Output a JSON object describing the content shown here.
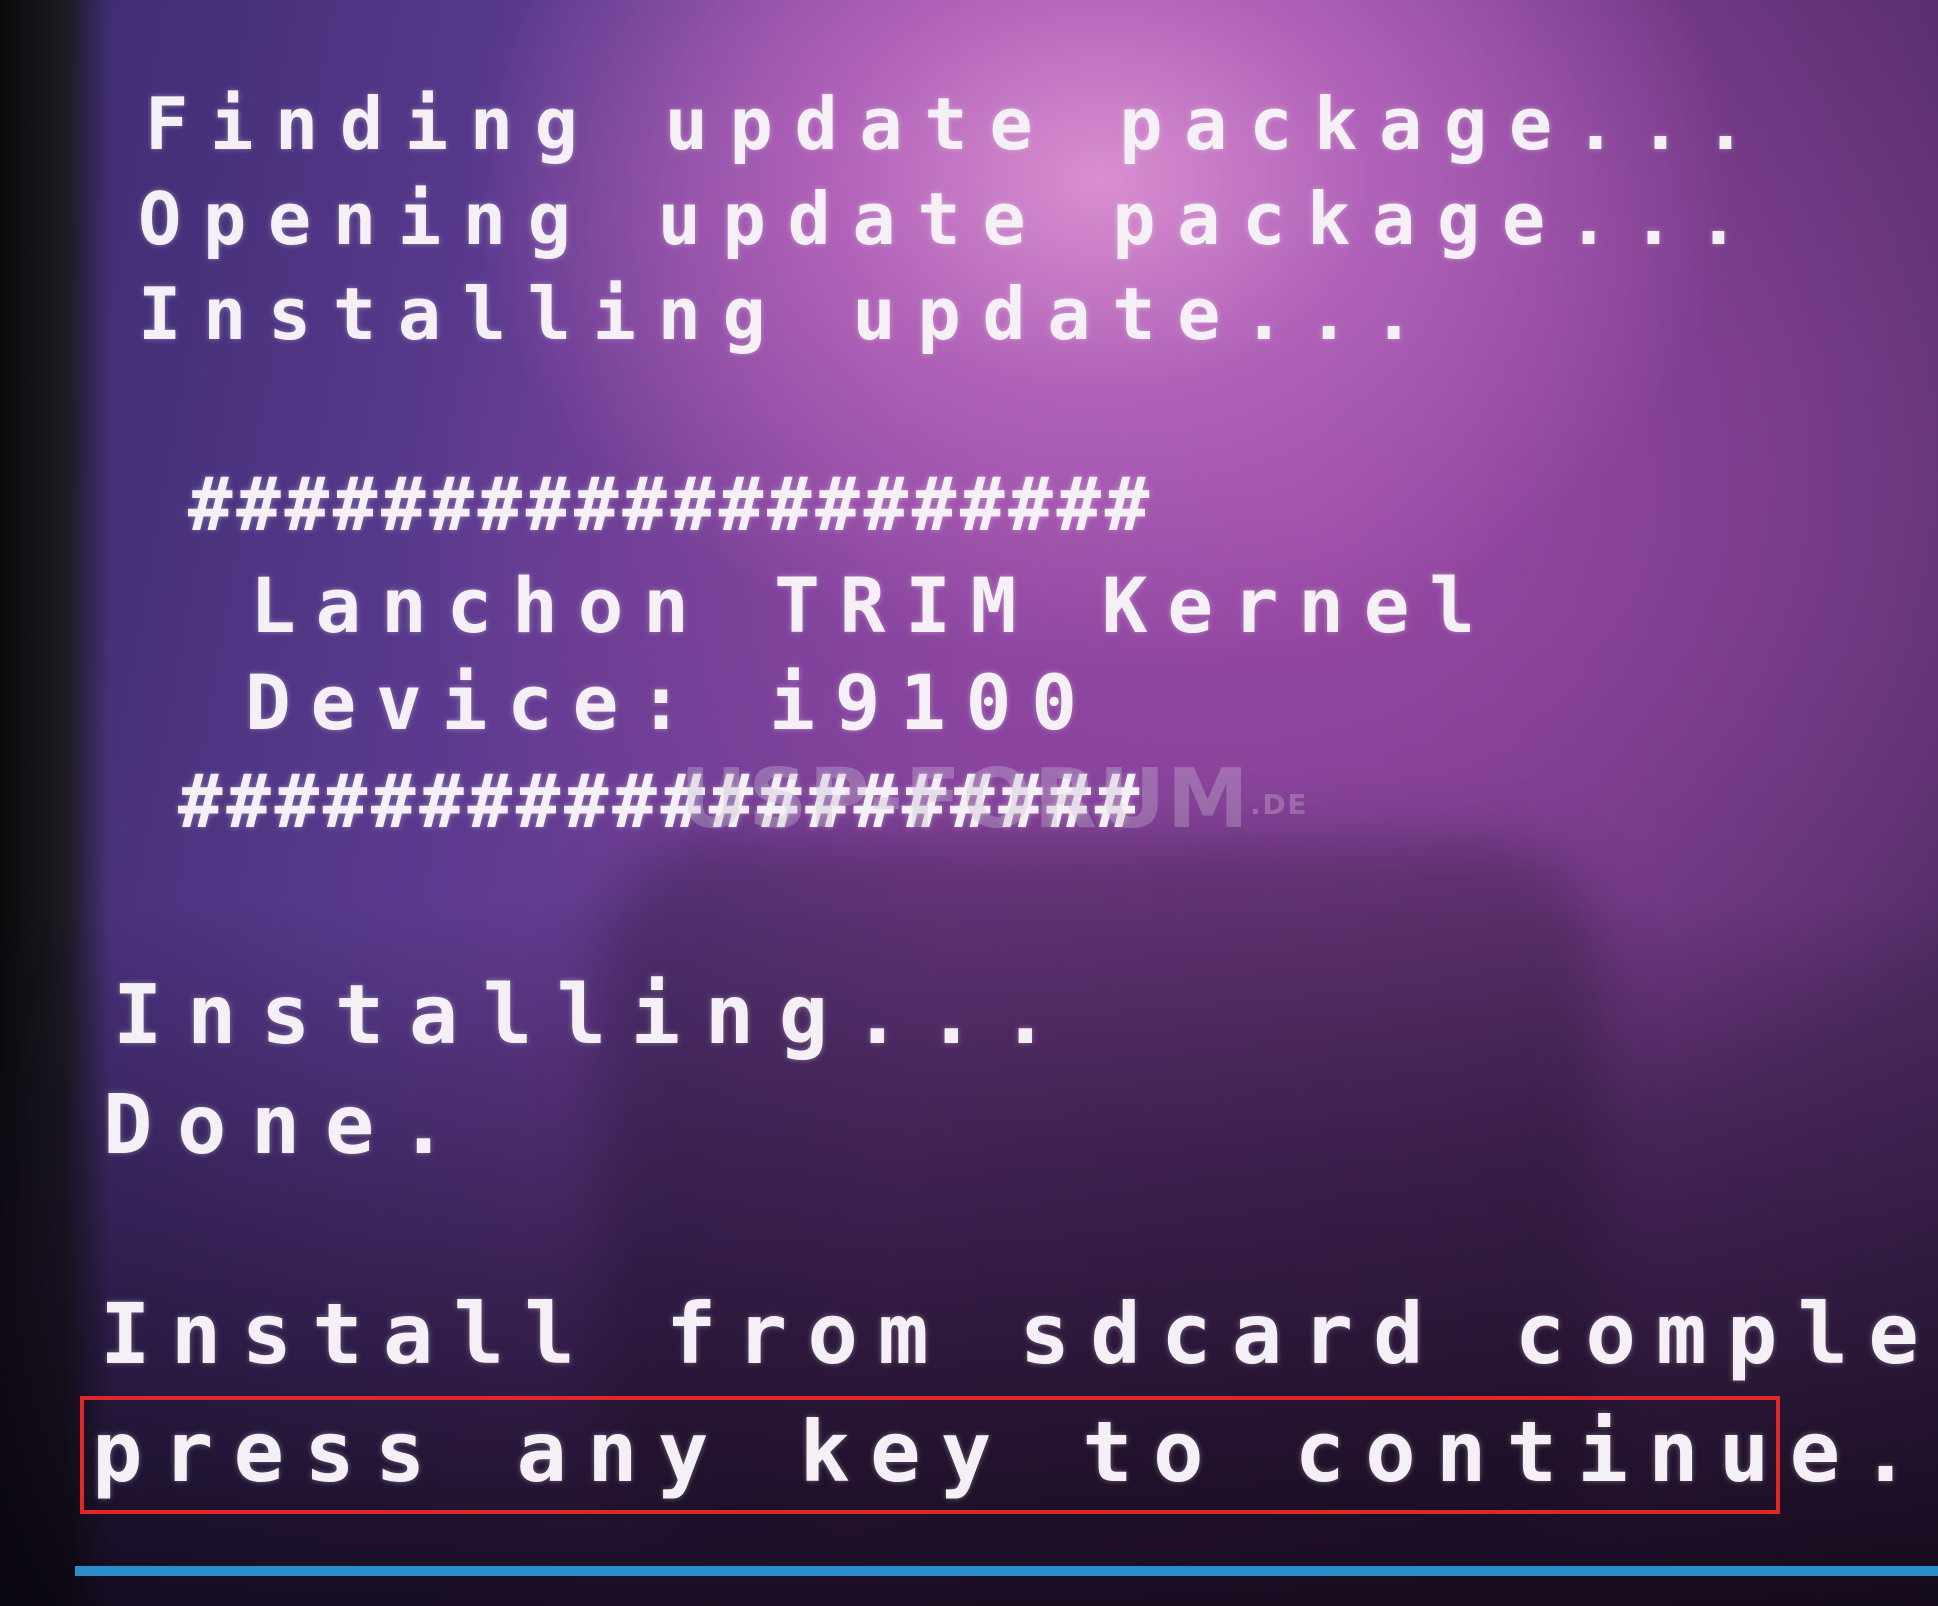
{
  "console_lines": [
    "Finding update package...",
    "Opening update package...",
    "Installing update...",
    "####################",
    "Lanchon TRIM Kernel",
    "Device: i9100",
    "####################",
    "Installing...",
    "Done.",
    "Install from sdcard complete",
    "press any key to continue."
  ],
  "watermark": {
    "text": "USP-FORUM",
    "suffix": ".DE"
  },
  "colors": {
    "text": "#f4f0f6",
    "highlight_border": "#e02828",
    "progress_bar": "#2a8fc8"
  }
}
